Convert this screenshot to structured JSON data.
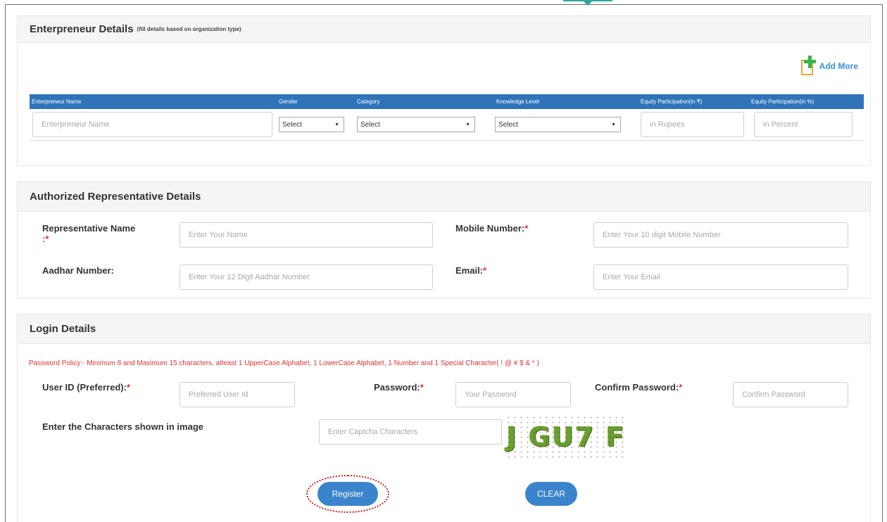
{
  "entrepreneur": {
    "title": "Enterpreneur Details",
    "subtitle": "(fill details based on organization type)",
    "add_more_label": "Add More",
    "columns": [
      "Enterpreneur Name",
      "Gender",
      "Category",
      "Knowledge Level",
      "Equity Participation(in ₹)",
      "Equity Participation(in %)"
    ],
    "row": {
      "name_placeholder": "Enterpreneur Name",
      "gender_value": "Select",
      "category_value": "Select",
      "knowledge_value": "Select",
      "equity_rupees_placeholder": "in Rupees",
      "equity_percent_placeholder": "in Percent"
    }
  },
  "authorized": {
    "title": "Authorized Representative Details",
    "rep_name_label": "Representative Name",
    "rep_name_req": ":*",
    "rep_name_placeholder": "Enter Your Name",
    "mobile_label": "Mobile Number:",
    "mobile_req": "*",
    "mobile_placeholder": "Enter Your 10 digit Mobile Number",
    "aadhar_label": "Aadhar Number:",
    "aadhar_placeholder": "Enter Your 12 Digit Aadhar Number",
    "email_label": "Email:",
    "email_req": "*",
    "email_placeholder": "Enter Your Email"
  },
  "login": {
    "title": "Login Details",
    "policy": "Password Policy:- Minimum 8 and Maximum 15 characters, atleast 1 UpperCase Alphabet, 1 LowerCase Alphabet, 1 Number and 1 Special Character( ! @ # $ & * )",
    "userid_label": "User ID (Preferred):",
    "userid_req": "*",
    "userid_placeholder": "Preferred User Id",
    "password_label": "Password:",
    "password_req": "*",
    "password_placeholder": "Your Password",
    "confirm_label": "Confirm Password:",
    "confirm_req": "*",
    "confirm_placeholder": "Confirm Password",
    "captcha_label": "Enter the Characters shown in image",
    "captcha_placeholder": "Enter Captcha Characters",
    "captcha_text": "J GU7 F",
    "register_label": "Register",
    "clear_label": "CLEAR"
  },
  "colors": {
    "accent": "#3a84cc",
    "table_header": "#2f74b9",
    "required": "#e53030",
    "highlight": "#d21a1a"
  }
}
